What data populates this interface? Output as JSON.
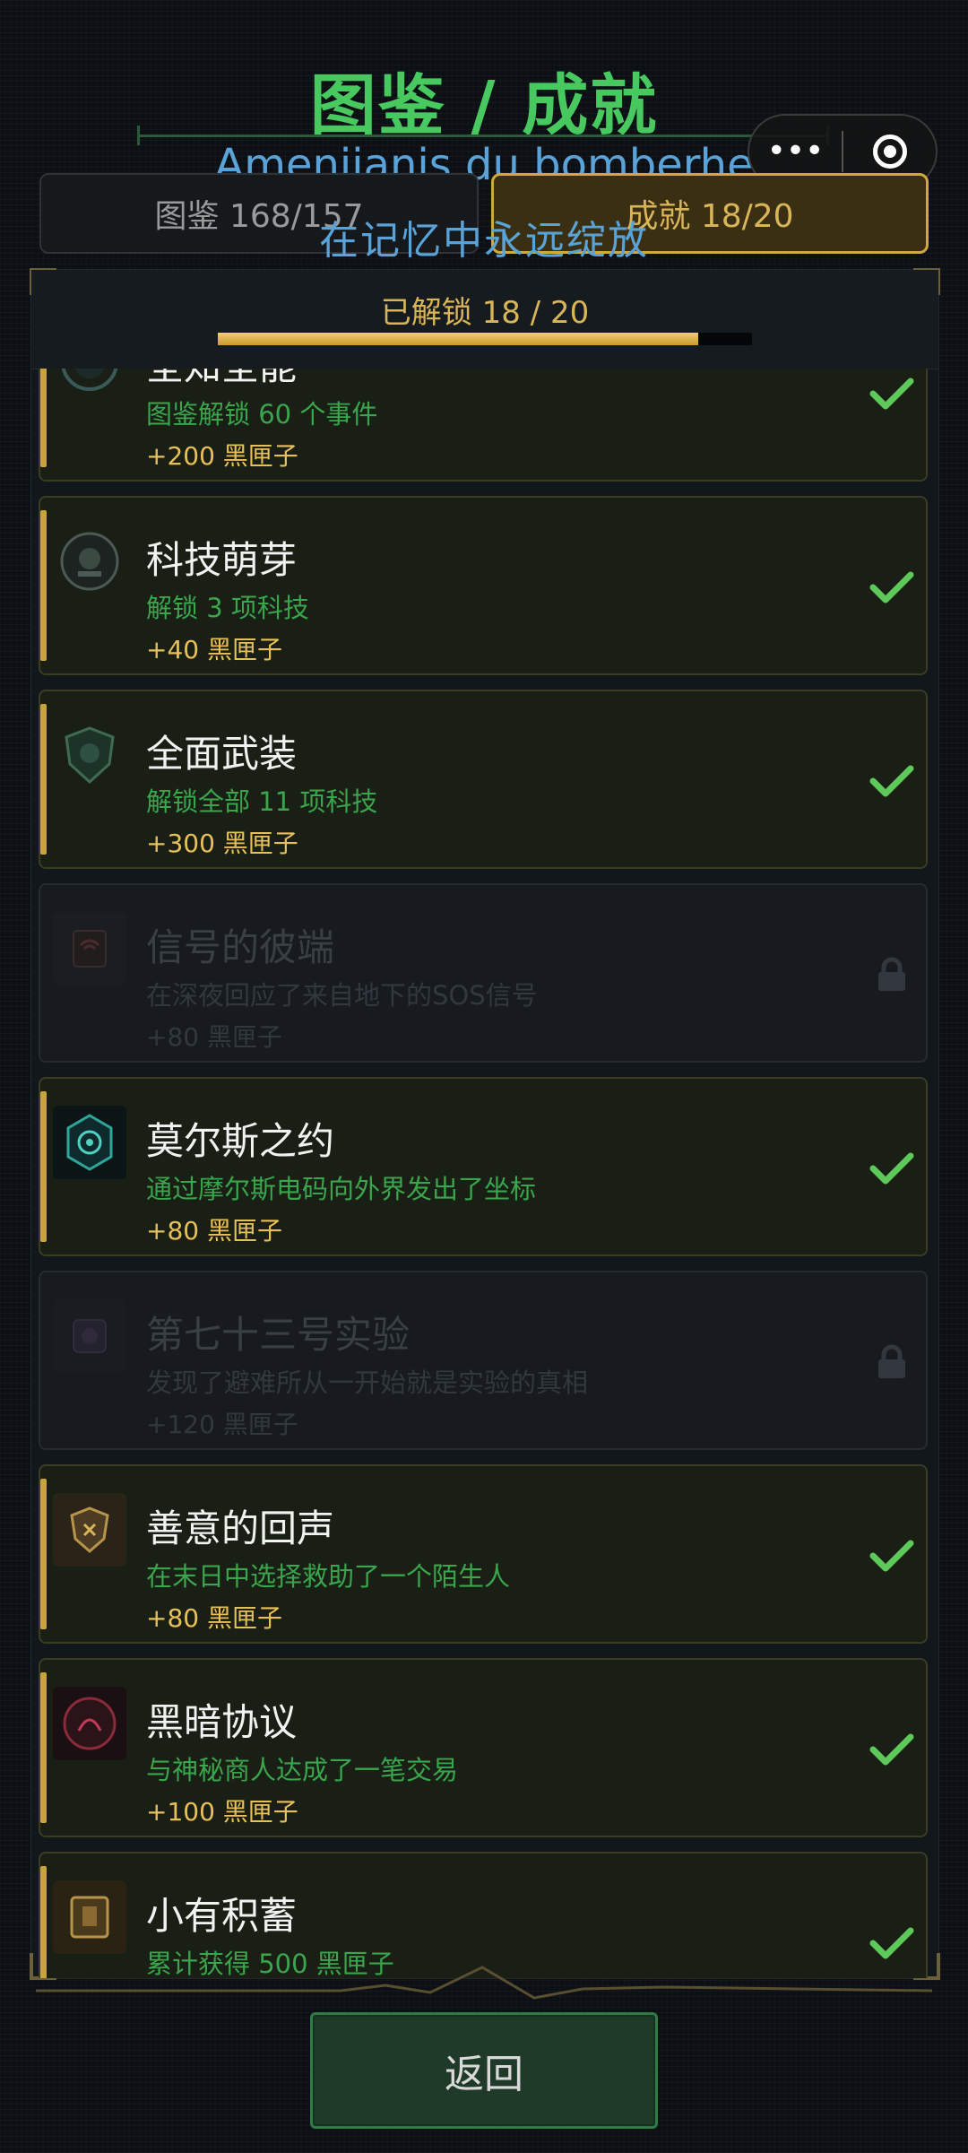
{
  "header": {
    "title": "图鉴 / 成就",
    "overlay_english": "Amenijanis du bomberhe",
    "overlay_chinese": "在记忆中永远绽放",
    "capsule_more": "•••"
  },
  "tabs": [
    {
      "label": "图鉴 168/157",
      "active": false
    },
    {
      "label": "成就 18/20",
      "active": true
    }
  ],
  "summary": {
    "text": "已解锁 18 / 20",
    "progress_fraction": 0.9
  },
  "achievements": [
    {
      "title": "全知全能",
      "desc": "图鉴解锁 60 个事件",
      "reward": "+200 黑匣子",
      "unlocked": true,
      "icon": "badge-icon"
    },
    {
      "title": "科技萌芽",
      "desc": "解锁 3 项科技",
      "reward": "+40 黑匣子",
      "unlocked": true,
      "icon": "gear-emblem-icon"
    },
    {
      "title": "全面武装",
      "desc": "解锁全部 11 项科技",
      "reward": "+300 黑匣子",
      "unlocked": true,
      "icon": "shield-emblem-icon"
    },
    {
      "title": "信号的彼端",
      "desc": "在深夜回应了来自地下的SOS信号",
      "reward": "+80 黑匣子",
      "unlocked": false,
      "icon": "radio-signal-icon"
    },
    {
      "title": "莫尔斯之约",
      "desc": "通过摩尔斯电码向外界发出了坐标",
      "reward": "+80 黑匣子",
      "unlocked": true,
      "icon": "compass-icon"
    },
    {
      "title": "第七十三号实验",
      "desc": "发现了避难所从一开始就是实验的真相",
      "reward": "+120 黑匣子",
      "unlocked": false,
      "icon": "experiment-icon"
    },
    {
      "title": "善意的回声",
      "desc": "在末日中选择救助了一个陌生人",
      "reward": "+80 黑匣子",
      "unlocked": true,
      "icon": "shield-badge-icon"
    },
    {
      "title": "黑暗协议",
      "desc": "与神秘商人达成了一笔交易",
      "reward": "+100 黑匣子",
      "unlocked": true,
      "icon": "dark-pact-icon"
    },
    {
      "title": "小有积蓄",
      "desc": "累计获得 500 黑匣子",
      "reward": "",
      "unlocked": true,
      "icon": "box-icon"
    }
  ],
  "footer": {
    "back_label": "返回"
  },
  "colors": {
    "accent_green": "#47c95f",
    "gold": "#d9b55a",
    "check_green": "#5ec95a",
    "background": "#0c1014"
  }
}
